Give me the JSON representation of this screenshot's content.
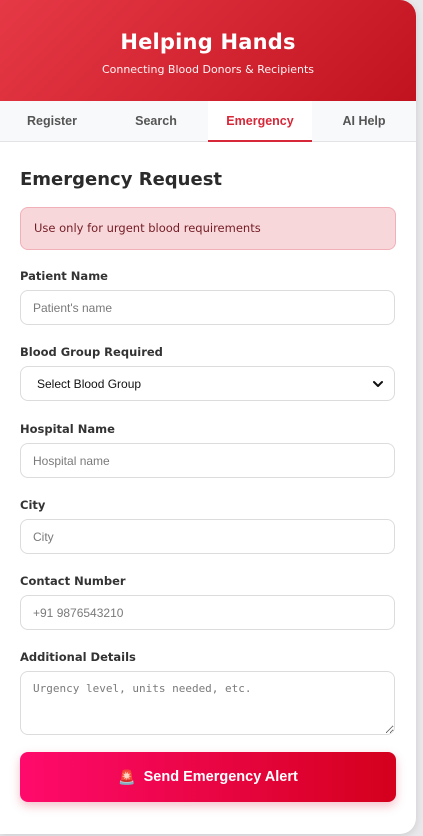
{
  "header": {
    "title": "Helping Hands",
    "subtitle": "Connecting Blood Donors & Recipients"
  },
  "tabs": [
    {
      "label": "Register",
      "active": false
    },
    {
      "label": "Search",
      "active": false
    },
    {
      "label": "Emergency",
      "active": true
    },
    {
      "label": "AI Help",
      "active": false
    }
  ],
  "section_title": "Emergency Request",
  "alert_text": "Use only for urgent blood requirements",
  "fields": {
    "patient_name": {
      "label": "Patient Name",
      "placeholder": "Patient's name",
      "value": ""
    },
    "blood_group": {
      "label": "Blood Group Required",
      "selected": "Select Blood Group"
    },
    "hospital": {
      "label": "Hospital Name",
      "placeholder": "Hospital name",
      "value": ""
    },
    "city": {
      "label": "City",
      "placeholder": "City",
      "value": ""
    },
    "contact": {
      "label": "Contact Number",
      "placeholder": "+91 9876543210",
      "value": ""
    },
    "details": {
      "label": "Additional Details",
      "placeholder": "Urgency level, units needed, etc.",
      "value": ""
    }
  },
  "submit": {
    "label": "Send Emergency Alert",
    "icon": "siren-icon"
  },
  "colors": {
    "brand": "#d62839",
    "header_gradient_start": "#e63946",
    "header_gradient_end": "#c1121f",
    "alert_bg": "#f8d7da",
    "button_gradient_start": "#ff0a6c",
    "button_gradient_end": "#d4001c"
  }
}
